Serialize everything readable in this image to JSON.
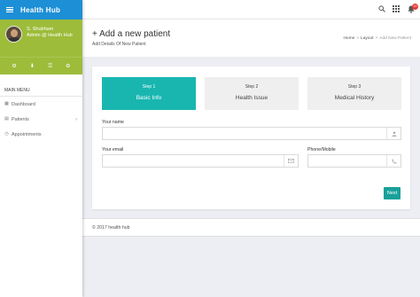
{
  "brand": {
    "title": "Health Hub"
  },
  "user": {
    "name": "S. Shubham",
    "role": "Admin @ Health Hub"
  },
  "user_actions": [
    {
      "icon": "settings-icon",
      "glyph": "⚙"
    },
    {
      "icon": "download-icon",
      "glyph": "⬇"
    },
    {
      "icon": "key-icon",
      "glyph": "⚿"
    },
    {
      "icon": "gear-icon",
      "glyph": "⚙"
    }
  ],
  "menu": {
    "header": "MAIN MENU",
    "items": [
      {
        "label": "Dashboard",
        "glyph": "▦"
      },
      {
        "label": "Patients",
        "glyph": "▤",
        "chevron": "›"
      },
      {
        "label": "Appointments",
        "glyph": "◷"
      }
    ]
  },
  "topbar": {
    "notification_count": "10"
  },
  "page": {
    "title": "+ Add a new patient",
    "subtitle": "Add Details Of New Patient",
    "breadcrumb": [
      "Home",
      "Layout",
      "Add New Patient"
    ]
  },
  "steps": [
    {
      "num": "Step 1",
      "name": "Basic Info"
    },
    {
      "num": "Step 2",
      "name": "Health Issue"
    },
    {
      "num": "Step 3",
      "name": "Medical History"
    }
  ],
  "form": {
    "name_label": "Your name",
    "name_value": "",
    "email_label": "Your email",
    "email_value": "",
    "phone_label": "Phone/Mobile",
    "phone_value": "",
    "next_label": "Next"
  },
  "footer": {
    "text": "© 2017 health hub"
  },
  "colors": {
    "brand": "#1d8fd6",
    "user_panel": "#9dbc3a",
    "active_step": "#19b6b0",
    "next_button": "#19a09a",
    "badge": "#e53935"
  }
}
